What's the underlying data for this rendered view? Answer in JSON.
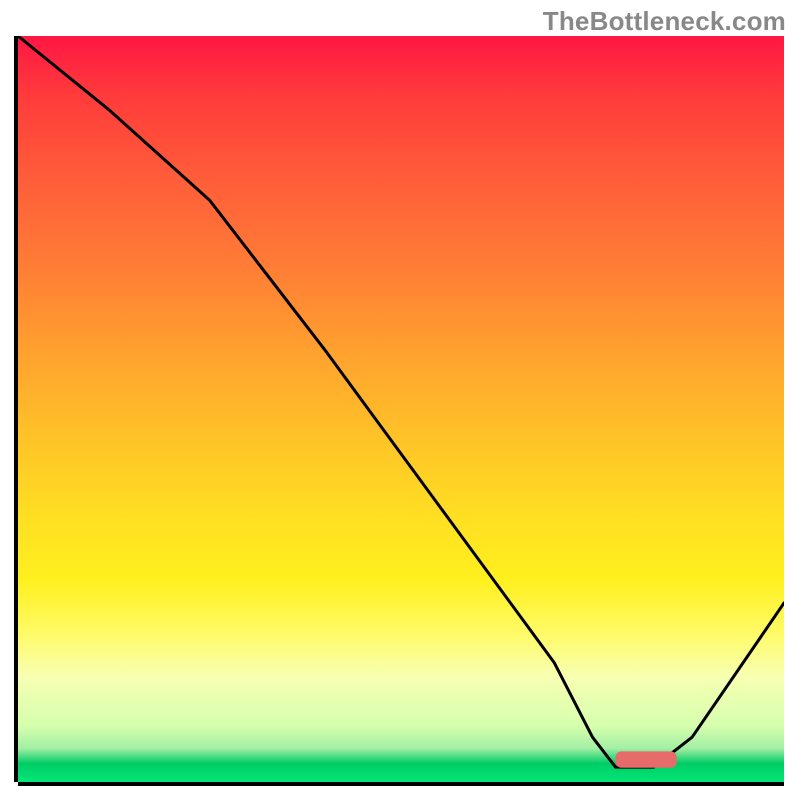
{
  "watermark": "TheBottleneck.com",
  "chart_data": {
    "type": "line",
    "title": "",
    "xlabel": "",
    "ylabel": "",
    "xlim": [
      0,
      100
    ],
    "ylim": [
      0,
      100
    ],
    "grid": false,
    "legend": false,
    "background": {
      "type": "vertical-gradient",
      "stops": [
        {
          "pos": 0.0,
          "color": "#ff1744"
        },
        {
          "pos": 0.08,
          "color": "#ff3b3b"
        },
        {
          "pos": 0.18,
          "color": "#ff5a3a"
        },
        {
          "pos": 0.3,
          "color": "#ff7a36"
        },
        {
          "pos": 0.42,
          "color": "#ffa02f"
        },
        {
          "pos": 0.55,
          "color": "#ffc627"
        },
        {
          "pos": 0.65,
          "color": "#ffe022"
        },
        {
          "pos": 0.73,
          "color": "#fff01f"
        },
        {
          "pos": 0.8,
          "color": "#fffb66"
        },
        {
          "pos": 0.86,
          "color": "#f7ffb3"
        },
        {
          "pos": 0.925,
          "color": "#d5ffad"
        },
        {
          "pos": 0.955,
          "color": "#a3efa5"
        },
        {
          "pos": 0.975,
          "color": "#00cc66"
        },
        {
          "pos": 1.0,
          "color": "#00e676"
        }
      ]
    },
    "series": [
      {
        "name": "curve",
        "color": "#000000",
        "x": [
          0,
          12,
          25,
          40,
          55,
          70,
          75,
          78,
          83,
          88,
          100
        ],
        "y": [
          100,
          90,
          78,
          58,
          37,
          16,
          6,
          2,
          2,
          6,
          24
        ]
      }
    ],
    "marker": {
      "name": "highlight-bar",
      "color": "#e86b6b",
      "x_start": 78,
      "x_end": 86,
      "y": 3,
      "thickness": 2.2
    }
  }
}
